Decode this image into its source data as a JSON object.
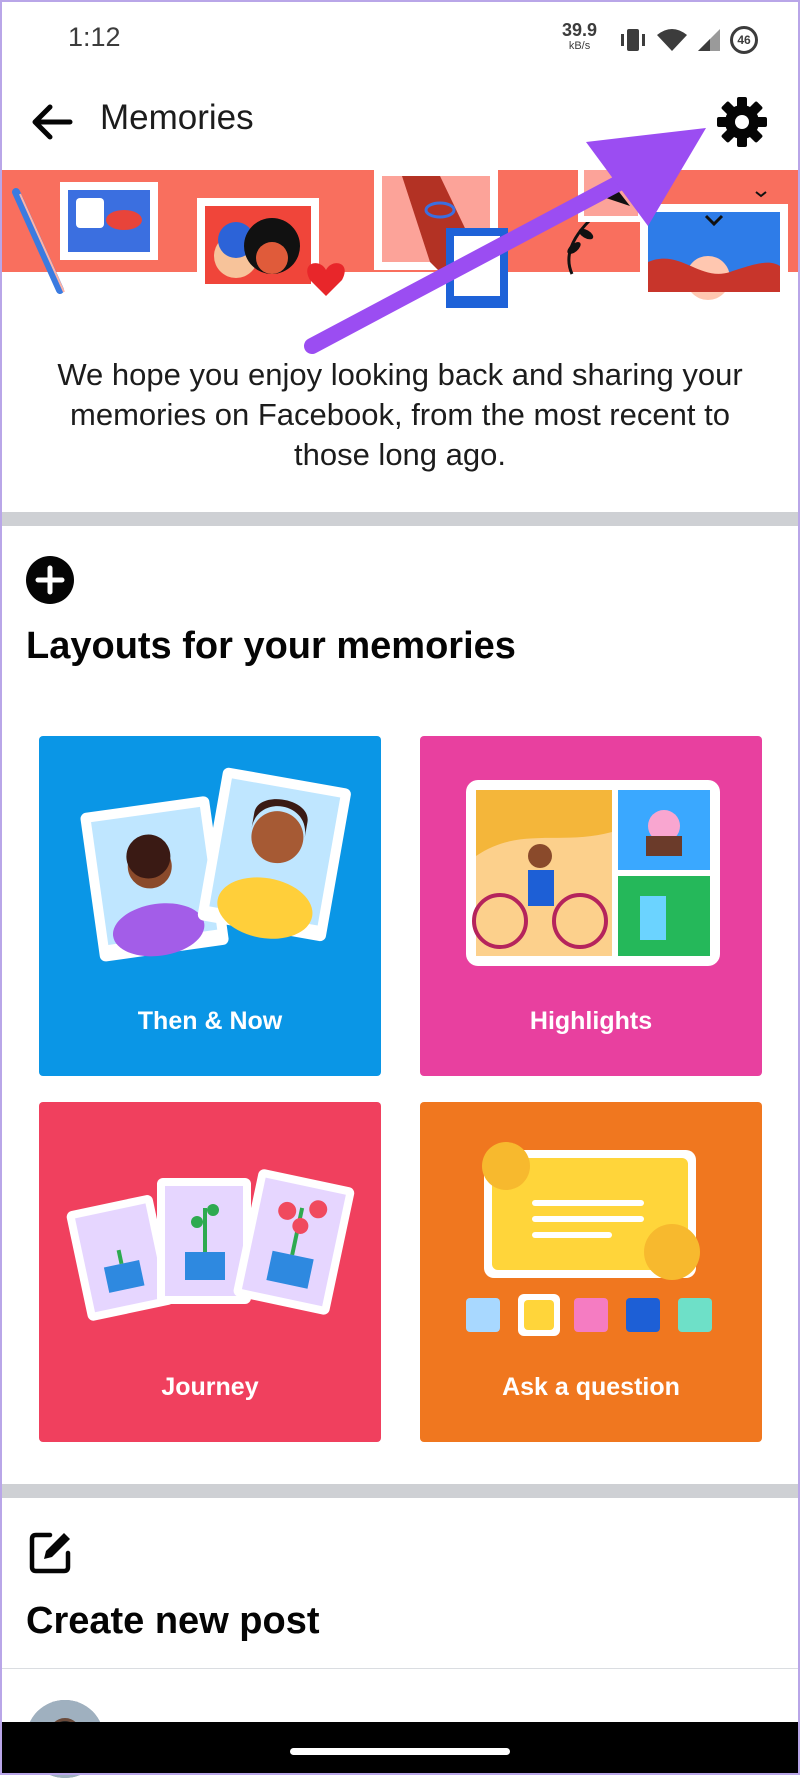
{
  "status_bar": {
    "time": "1:12",
    "speed_value": "39.9",
    "speed_unit": "kB/s",
    "battery": "46"
  },
  "app_bar": {
    "title": "Memories",
    "back_icon": "arrow-left-icon",
    "settings_icon": "gear-icon"
  },
  "intro_text": "We hope you enjoy looking back and sharing your memories on Facebook, from the most recent to those long ago.",
  "layouts": {
    "title": "Layouts for your memories",
    "cards": [
      {
        "label": "Then & Now",
        "color": "#0a96e6"
      },
      {
        "label": "Highlights",
        "color": "#e8409f"
      },
      {
        "label": "Journey",
        "color": "#f0405e"
      },
      {
        "label": "Ask a question",
        "color": "#f0771f"
      }
    ]
  },
  "create_post": {
    "title": "Create new post"
  },
  "colors": {
    "banner": "#f96f5e",
    "annotation_arrow": "#9b4df2",
    "divider": "#ced0d4"
  }
}
